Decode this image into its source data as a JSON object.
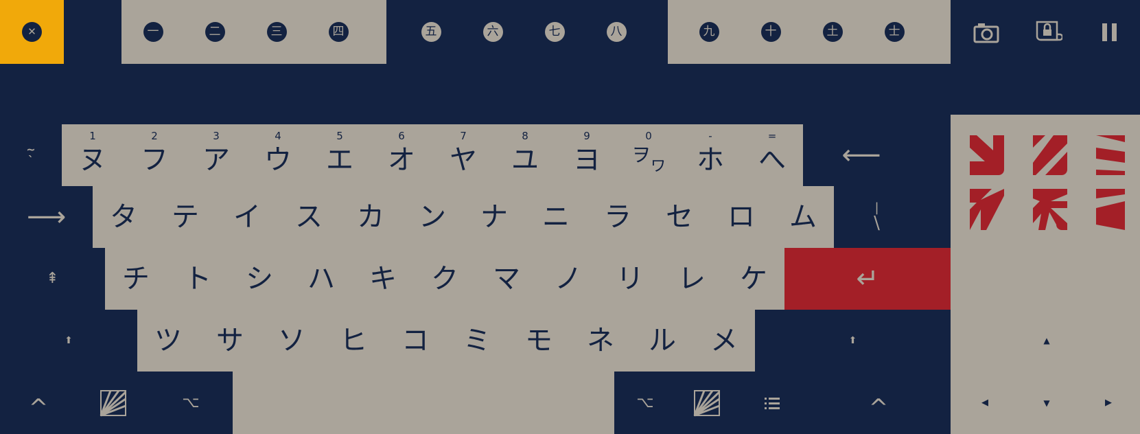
{
  "close_label": "✕",
  "numbers_group_a": [
    "一",
    "二",
    "三",
    "四"
  ],
  "numbers_group_b": [
    "五",
    "六",
    "七",
    "八"
  ],
  "numbers_group_c": [
    "九",
    "十",
    "土",
    "士"
  ],
  "icons": {
    "camera": "camera-icon",
    "lock_scroll": "lock-scroll-icon",
    "pause": "pause-icon",
    "backspace": "backspace-arrow-icon",
    "tab": "tab-arrow-icon",
    "capslock": "caps-lock-icon",
    "shift": "shift-icon",
    "enter": "enter-icon",
    "ctrl": "ctrl-caret-icon",
    "alt": "option-icon",
    "logo": "rising-sun-logo-icon",
    "menu": "menu-list-icon"
  },
  "row1": {
    "tilde": {
      "top": "~",
      "bottom": "`"
    },
    "keys": [
      {
        "shift": "1",
        "kana": "ヌ"
      },
      {
        "shift": "2",
        "kana": "フ"
      },
      {
        "shift": "3",
        "kana": "ア"
      },
      {
        "shift": "4",
        "kana": "ウ"
      },
      {
        "shift": "5",
        "kana": "エ"
      },
      {
        "shift": "6",
        "kana": "オ"
      },
      {
        "shift": "7",
        "kana": "ヤ"
      },
      {
        "shift": "8",
        "kana": "ユ"
      },
      {
        "shift": "9",
        "kana": "ヨ"
      },
      {
        "shift": "0",
        "kana": "ヲ",
        "kana_sub": "ワ"
      },
      {
        "shift": "-",
        "kana": "ホ"
      },
      {
        "shift": "=",
        "kana": "へ"
      }
    ],
    "backspace_label": "⟵"
  },
  "row2": {
    "tab_label": "⟶",
    "keys": [
      "タ",
      "テ",
      "イ",
      "ス",
      "カ",
      "ン",
      "ナ",
      "ニ",
      "ラ",
      "セ",
      "ロ",
      "ム"
    ],
    "pipe": {
      "top": "|",
      "bottom": "\\"
    }
  },
  "row3": {
    "caps_label": "⇞",
    "keys": [
      "チ",
      "ト",
      "シ",
      "ハ",
      "キ",
      "ク",
      "マ",
      "ノ",
      "リ",
      "レ",
      "ケ"
    ],
    "enter_label": "↵"
  },
  "row4": {
    "shift_label": "⬆",
    "keys": [
      "ツ",
      "サ",
      "ソ",
      "ヒ",
      "コ",
      "ミ",
      "モ",
      "ネ",
      "ル",
      "メ"
    ],
    "rshift_label": "⬆"
  },
  "row5": {
    "ctrl_label": "^",
    "alt_label": "⌥"
  },
  "arrows": {
    "up": "▲",
    "left": "◀",
    "down": "▼",
    "right": "▶"
  },
  "colors": {
    "background": "#132241",
    "key": "#aaa49a",
    "accent_red": "#a31f27",
    "accent_orange": "#f1a90a"
  }
}
